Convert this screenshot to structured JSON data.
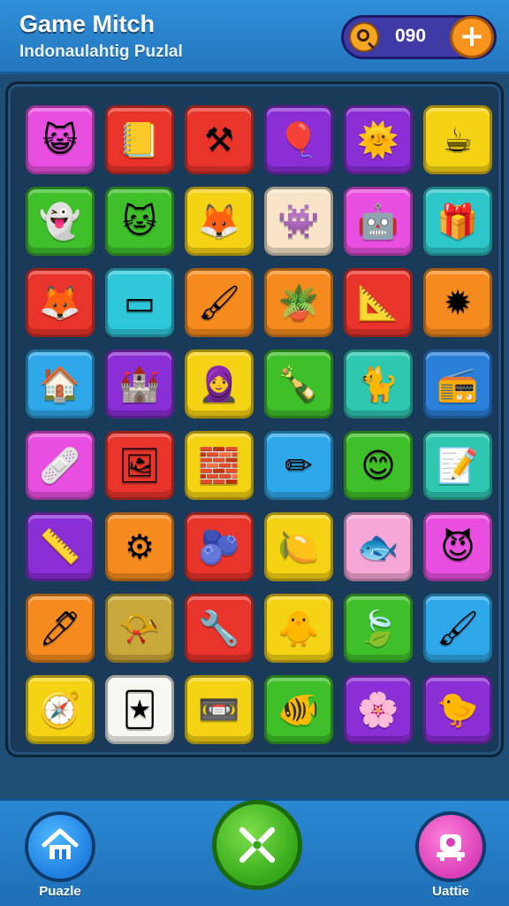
{
  "header": {
    "title": "Game Mitch",
    "subtitle": "Indonaulahtig Puzlal",
    "coins": "090",
    "plus_label": "+"
  },
  "board": {
    "tiles": [
      {
        "color": "#e84fe0",
        "icon": "cat-face-icon",
        "glyph": "😺"
      },
      {
        "color": "#e8342a",
        "icon": "notebook-icon",
        "glyph": "📒"
      },
      {
        "color": "#e8342a",
        "icon": "crossed-tools-icon",
        "glyph": "⚒"
      },
      {
        "color": "#8a2ed6",
        "icon": "balloon-icon",
        "glyph": "🎈"
      },
      {
        "color": "#8a2ed6",
        "icon": "sun-face-icon",
        "glyph": "🌞"
      },
      {
        "color": "#f4d214",
        "icon": "mug-icon",
        "glyph": "☕"
      },
      {
        "color": "#3fbf2a",
        "icon": "ghost-icon",
        "glyph": "👻"
      },
      {
        "color": "#3fbf2a",
        "icon": "cat-face-icon",
        "glyph": "🐱"
      },
      {
        "color": "#f4d214",
        "icon": "fox-face-icon",
        "glyph": "🦊"
      },
      {
        "color": "#f6e3c8",
        "icon": "blob-creature-icon",
        "glyph": "👾"
      },
      {
        "color": "#e84fe0",
        "icon": "robot-icon",
        "glyph": "🤖"
      },
      {
        "color": "#2ec7c9",
        "icon": "gift-bag-icon",
        "glyph": "🎁"
      },
      {
        "color": "#e8342a",
        "icon": "fox-face-icon",
        "glyph": "🦊"
      },
      {
        "color": "#2ec7d9",
        "icon": "tablet-icon",
        "glyph": "▭"
      },
      {
        "color": "#f58a1f",
        "icon": "paint-tube-icon",
        "glyph": "🖌"
      },
      {
        "color": "#f58a1f",
        "icon": "flower-pot-icon",
        "glyph": "🪴"
      },
      {
        "color": "#e8342a",
        "icon": "ruler-icon",
        "glyph": "📐"
      },
      {
        "color": "#f58a1f",
        "icon": "spiky-star-icon",
        "glyph": "✹"
      },
      {
        "color": "#2ea8e8",
        "icon": "palm-house-icon",
        "glyph": "🏠"
      },
      {
        "color": "#8a2ed6",
        "icon": "castle-block-icon",
        "glyph": "🏰"
      },
      {
        "color": "#f4d214",
        "icon": "pharaoh-icon",
        "glyph": "🧕"
      },
      {
        "color": "#3fbf2a",
        "icon": "bottle-icon",
        "glyph": "🍾"
      },
      {
        "color": "#2ec7b0",
        "icon": "cat-face-icon",
        "glyph": "🐈"
      },
      {
        "color": "#2a7fd8",
        "icon": "radio-icon",
        "glyph": "📻"
      },
      {
        "color": "#e84fe0",
        "icon": "bandage-icon",
        "glyph": "🩹"
      },
      {
        "color": "#e8342a",
        "icon": "picture-frame-icon",
        "glyph": "🖼"
      },
      {
        "color": "#f4d214",
        "icon": "brick-block-icon",
        "glyph": "🧱"
      },
      {
        "color": "#2ea8e8",
        "icon": "pencil-icon",
        "glyph": "✏"
      },
      {
        "color": "#3fbf2a",
        "icon": "smiley-icon",
        "glyph": "😊"
      },
      {
        "color": "#2ec7b0",
        "icon": "paper-note-icon",
        "glyph": "📝"
      },
      {
        "color": "#8a2ed6",
        "icon": "compass-square-icon",
        "glyph": "📏"
      },
      {
        "color": "#f58a1f",
        "icon": "gear-ring-icon",
        "glyph": "⚙"
      },
      {
        "color": "#e8342a",
        "icon": "berry-icon",
        "glyph": "🫐"
      },
      {
        "color": "#f4d214",
        "icon": "lemon-face-icon",
        "glyph": "🍋"
      },
      {
        "color": "#f7a6d8",
        "icon": "fish-face-icon",
        "glyph": "🐟"
      },
      {
        "color": "#e84fe0",
        "icon": "devil-face-icon",
        "glyph": "😈"
      },
      {
        "color": "#f58a1f",
        "icon": "pen-icon",
        "glyph": "🖊"
      },
      {
        "color": "#c8a83a",
        "icon": "horn-icon",
        "glyph": "📯"
      },
      {
        "color": "#e8342a",
        "icon": "crossed-wrench-icon",
        "glyph": "🔧"
      },
      {
        "color": "#f4d214",
        "icon": "bird-face-icon",
        "glyph": "🐥"
      },
      {
        "color": "#3fbf2a",
        "icon": "leaf-creature-icon",
        "glyph": "🍃"
      },
      {
        "color": "#2ea8e8",
        "icon": "brush-icon",
        "glyph": "🖌"
      },
      {
        "color": "#f4d214",
        "icon": "compass-icon",
        "glyph": "🧭"
      },
      {
        "color": "#f8f8f2",
        "icon": "card-icon",
        "glyph": "🃏"
      },
      {
        "color": "#f4d214",
        "icon": "cassette-icon",
        "glyph": "📼"
      },
      {
        "color": "#3fbf2a",
        "icon": "fish-creature-icon",
        "glyph": "🐠"
      },
      {
        "color": "#8a2ed6",
        "icon": "sun-flower-icon",
        "glyph": "🌸"
      },
      {
        "color": "#8a2ed6",
        "icon": "bird-creature-icon",
        "glyph": "🐤"
      }
    ]
  },
  "footer": {
    "left_label": "Puazle",
    "right_label": "Uattie"
  }
}
